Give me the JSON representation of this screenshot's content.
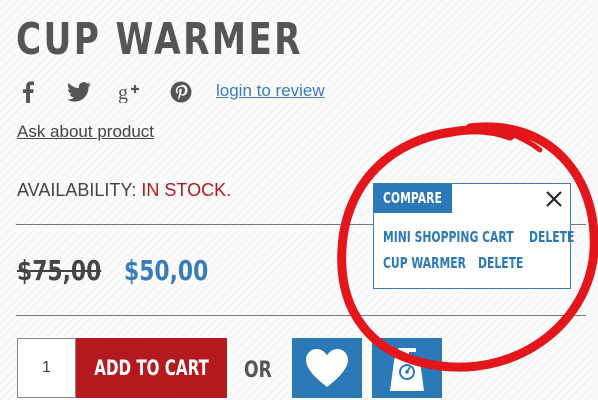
{
  "product": {
    "title": "CUP WARMER",
    "login_review": "login to review",
    "ask_product": "Ask about product",
    "availability_label": "AVAILABILITY: ",
    "availability_value": "IN STOCK.",
    "price_old": "$75,00",
    "price_new": "$50,00"
  },
  "social": [
    {
      "icon": "facebook-icon"
    },
    {
      "icon": "twitter-icon"
    },
    {
      "icon": "google-plus-icon"
    },
    {
      "icon": "pinterest-icon"
    }
  ],
  "cart": {
    "quantity": "1",
    "add_to_cart": "ADD TO CART",
    "or": "OR",
    "wishlist_icon": "heart-icon",
    "compare_icon": "scale-icon"
  },
  "compare": {
    "title": "COMPARE",
    "items": [
      {
        "name": "MINI SHOPPING CART",
        "delete": "DELETE"
      },
      {
        "name": "CUP WARMER",
        "delete": "DELETE"
      }
    ]
  },
  "colors": {
    "accent_blue": "#2b7ab7",
    "accent_red": "#b3191d",
    "text": "#444444"
  }
}
